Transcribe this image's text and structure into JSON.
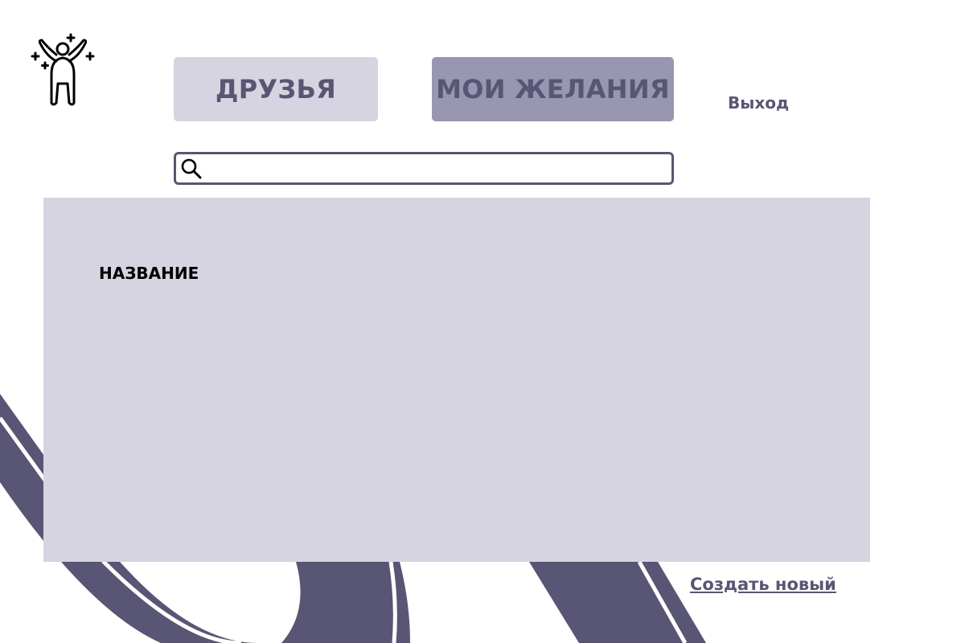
{
  "header": {
    "logo_icon": "person-celebrate-icon"
  },
  "nav": {
    "friends_label": "ДРУЗЬЯ",
    "wishes_label": "МОИ ЖЕЛАНИЯ",
    "active_tab": "wishes",
    "logout_label": "Выход"
  },
  "search": {
    "icon": "search-icon",
    "value": "",
    "placeholder": ""
  },
  "wish_list": {
    "items": [
      {
        "title": "НАЗВАНИЕ"
      }
    ]
  },
  "actions": {
    "create_label": "Создать новый"
  },
  "colors": {
    "accent": "#585674",
    "panel_bg": "#d6d4e0",
    "active_tab_bg": "#9896b0",
    "background": "#ffffff"
  }
}
